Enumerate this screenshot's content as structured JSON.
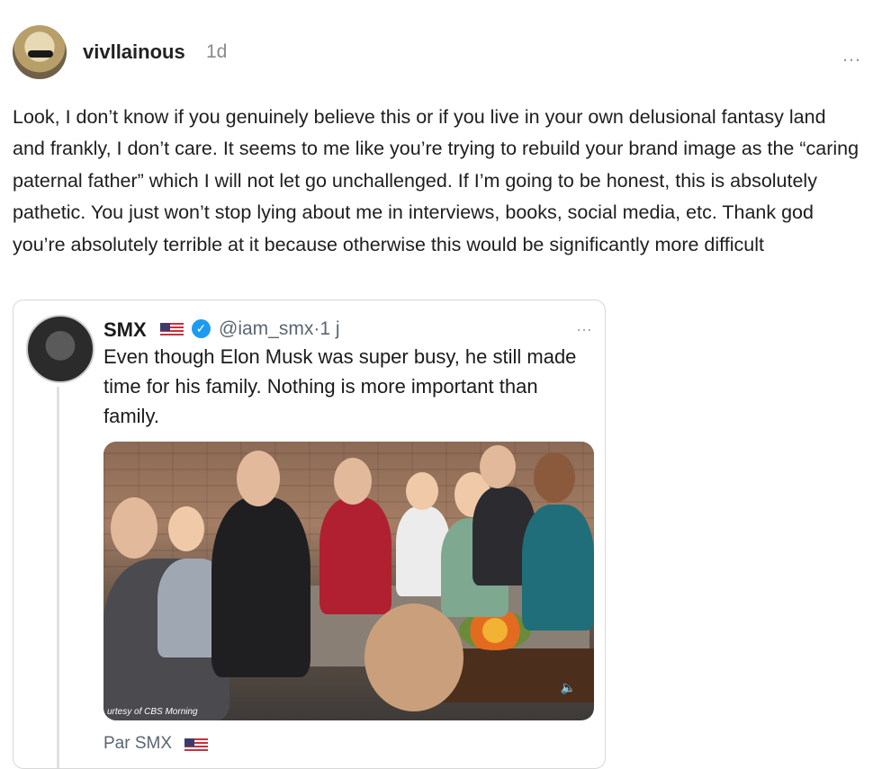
{
  "post": {
    "username": "vivllainous",
    "time": "1d",
    "more": "…",
    "body": "Look, I don’t know if you genuinely believe this or if you live in your own delusional fantasy land and frankly, I don’t care. It seems to me like you’re trying to rebuild your brand image as the “caring paternal father” which I will not let go unchallenged. If I’m going to be honest, this is absolutely pathetic. You just won’t stop lying about me in interviews, books, social media, etc. Thank god you’re absolutely terrible at it because otherwise this would be significantly more difficult"
  },
  "embed": {
    "name": "SMX",
    "handle": "@iam_smx·1 j",
    "more": "…",
    "text": "Even though Elon Musk was super busy, he still made time for his family. Nothing is more important than family.",
    "media_caption": "urtesy of CBS Morning",
    "footer": "Par SMX"
  }
}
